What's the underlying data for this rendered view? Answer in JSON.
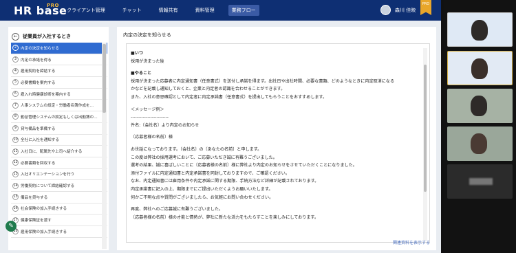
{
  "header": {
    "logo": "HR base",
    "logo_pro": "PRO",
    "nav": [
      "クライアント管理",
      "チャット",
      "情報共有",
      "資料管理",
      "業務フロー"
    ],
    "active_nav": 4,
    "user_name": "森川 佳映",
    "badge": "PRO"
  },
  "sidebar": {
    "title": "従業員が入社するとき",
    "steps": [
      {
        "num": "2",
        "label": "内定の決定を知らせる"
      },
      {
        "num": "3",
        "label": "内定の承諾を得る"
      },
      {
        "num": "4",
        "label": "雇用契約を締結する"
      },
      {
        "num": "5",
        "label": "必要書類を案内する"
      },
      {
        "num": "6",
        "label": "雇入れ時健康診断を案内する"
      },
      {
        "num": "7",
        "label": "人事システムの設定・労働者名簿作成を…"
      },
      {
        "num": "8",
        "label": "勤怠管理システムの設定もしくは出勤簿の…"
      },
      {
        "num": "9",
        "label": "貸与備品を準備する"
      },
      {
        "num": "10",
        "label": "全社に入社を通知する"
      },
      {
        "num": "11",
        "label": "入社日に、配属先や上司へ紹介する"
      },
      {
        "num": "12",
        "label": "必要書類を回収する"
      },
      {
        "num": "13",
        "label": "入社オリエンテーションを行う"
      },
      {
        "num": "14",
        "label": "労働契約について締結確認する"
      },
      {
        "num": "15",
        "label": "備品を貸与する"
      },
      {
        "num": "16",
        "label": "社会保険の加入手続きする"
      },
      {
        "num": "17",
        "label": "健康保険証を渡す"
      },
      {
        "num": "18",
        "label": "雇用保険の加入手続きする"
      }
    ],
    "active_step": 0
  },
  "main": {
    "title": "内定の決定を知らせる",
    "lines": [
      {
        "t": "■いつ",
        "b": true
      },
      {
        "t": "採用が決まった後"
      },
      {
        "t": "",
        "gap": true
      },
      {
        "t": "■やること",
        "b": true
      },
      {
        "t": "採用が決まった応募者に内定通知書（任意書式）を送付し承諾を得ます。出社日や出社時間、必要な書類、どのようなときに内定取消になる"
      },
      {
        "t": "かなどを記載し通知しておくと、企業と内定者の認識を合わせることができます。"
      },
      {
        "t": "また、入社の意思確認として内定者に内定承諾書（任意書式）を提出してもらうことをおすすめします。"
      },
      {
        "t": "",
        "gap": true
      },
      {
        "t": "＜メッセージ例＞"
      },
      {
        "t": "-------------------------"
      },
      {
        "t": "件名:〔会社名〕より内定のお知らせ"
      },
      {
        "t": "",
        "gap": true
      },
      {
        "t": "〔応募者様の名前〕様"
      },
      {
        "t": "",
        "gap": true
      },
      {
        "t": "お世話になっております。〔会社名〕の〔あなたの名前〕と申します。"
      },
      {
        "t": "この度は弊社の採用選考において、ご応募いただき誠に有難うございました。"
      },
      {
        "t": "選考の結果、誠に喜ばしいことに〔応募者様の名前〕様に弊社より内定のお知らせをさせていただくことになりました。"
      },
      {
        "t": "添付ファイルに内定通知書と内定承諾書を同封しておりますので、ご確認ください。"
      },
      {
        "t": "なお、内定通知書には雇用条件や内定承諾に関する期限、手続方法など詳細が記載されております。"
      },
      {
        "t": "内定承諾書に記入の上、期限までにご提出いただくようお願いいたします。"
      },
      {
        "t": "何かご不明な点や質問がございましたら、お気軽にお問い合わせください。"
      },
      {
        "t": "",
        "gap": true
      },
      {
        "t": "再度、弊社へのご応募誠に有難うございました。"
      },
      {
        "t": "〔応募者様の名前〕様の才能と情熱が、弊社に新たな活力をもたらすことを楽しみにしております。"
      }
    ],
    "related_link": "関連資料を表示する"
  },
  "fab_icon": "pencil-icon",
  "video_tiles": [
    "participant-1",
    "participant-2",
    "participant-3",
    "participant-4",
    "participant-5"
  ]
}
